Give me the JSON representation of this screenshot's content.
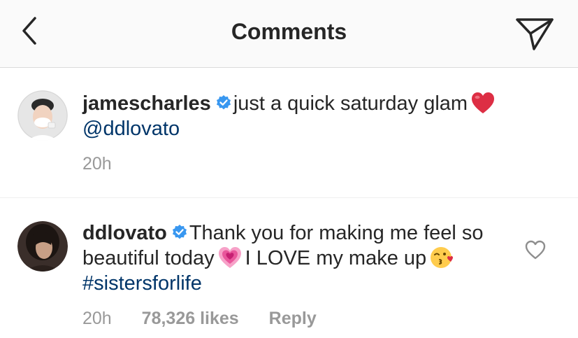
{
  "header": {
    "title": "Comments"
  },
  "comments": [
    {
      "username": "jamescharles",
      "text_before_emoji": "just a quick saturday glam",
      "mention": "@ddlovato",
      "timestamp": "20h"
    },
    {
      "username": "ddlovato",
      "text_part1": "Thank you for making me feel so beautiful today",
      "text_part2": "I LOVE my make up",
      "hashtag": "#sistersforlife",
      "timestamp": "20h",
      "likes": "78,326 likes",
      "reply_label": "Reply"
    }
  ],
  "icons": {
    "back": "chevron-left-icon",
    "send": "paper-plane-icon",
    "verified": "verified-badge-icon",
    "like": "heart-outline-icon"
  },
  "colors": {
    "link": "#003569",
    "verified": "#3897f0",
    "meta": "#999999",
    "heart": "#ed4956"
  }
}
